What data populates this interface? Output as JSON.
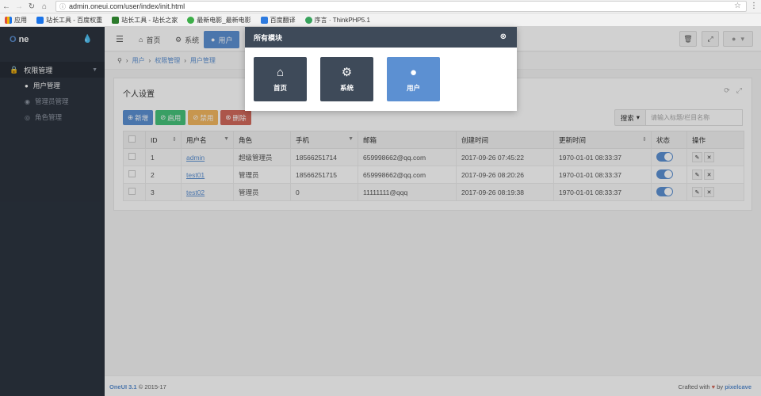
{
  "browser": {
    "url": "admin.oneui.com/user/index/init.html",
    "bookmarks": [
      {
        "label": "应用",
        "color": "#e04e39"
      },
      {
        "label": "站长工具 - 百度权重",
        "color": "#1a73e8"
      },
      {
        "label": "站长工具 - 站长之家",
        "color": "#2b7a2b"
      },
      {
        "label": "最新电影_最新电影",
        "color": "#3cae48"
      },
      {
        "label": "百度翻译",
        "color": "#2d7be0"
      },
      {
        "label": "序言 · ThinkPHP5.1",
        "color": "#37a35c"
      }
    ]
  },
  "sidebar": {
    "brand_o": "O",
    "brand_text": "ne",
    "section_label": "权限管理",
    "items": [
      {
        "label": "用户管理",
        "active": true
      },
      {
        "label": "管理员管理",
        "active": false
      },
      {
        "label": "角色管理",
        "active": false
      }
    ]
  },
  "header": {
    "tabs": [
      {
        "label": "首页",
        "icon": "home-icon"
      },
      {
        "label": "系统",
        "icon": "gear-icon"
      },
      {
        "label": "用户",
        "icon": "user-icon"
      }
    ]
  },
  "breadcrumb": {
    "items": [
      "用户",
      "权限管理",
      "用户管理"
    ]
  },
  "panel": {
    "title": "个人设置",
    "buttons": {
      "add": "新增",
      "enable": "启用",
      "disable": "禁用",
      "delete": "删除"
    },
    "search_label": "搜索",
    "search_placeholder": "请输入标题/栏目名称"
  },
  "table": {
    "headers": [
      "",
      "ID",
      "用户名",
      "角色",
      "手机",
      "邮箱",
      "创建时间",
      "更新时间",
      "状态",
      "操作"
    ],
    "rows": [
      {
        "id": "1",
        "username": "admin",
        "role": "超级管理员",
        "phone": "18566251714",
        "email": "659998662@qq.com",
        "created": "2017-09-26 07:45:22",
        "updated": "1970-01-01 08:33:37",
        "status": true
      },
      {
        "id": "2",
        "username": "test01",
        "role": "管理员",
        "phone": "18566251715",
        "email": "659998662@qq.com",
        "created": "2017-09-26 08:20:26",
        "updated": "1970-01-01 08:33:37",
        "status": true
      },
      {
        "id": "3",
        "username": "test02",
        "role": "管理员",
        "phone": "0",
        "email": "11111111@qqq",
        "created": "2017-09-26 08:19:38",
        "updated": "1970-01-01 08:33:37",
        "status": true
      }
    ]
  },
  "footer": {
    "brand": "OneUI 3.1",
    "copyright": "© 2015-17",
    "crafted_prefix": "Crafted with",
    "crafted_by": "by",
    "author": "pixelcave"
  },
  "modal": {
    "title": "所有模块",
    "tiles": [
      {
        "label": "首页",
        "icon": "home-icon",
        "active": false
      },
      {
        "label": "系统",
        "icon": "gear-icon",
        "active": false
      },
      {
        "label": "用户",
        "icon": "user-icon",
        "active": true
      }
    ]
  }
}
